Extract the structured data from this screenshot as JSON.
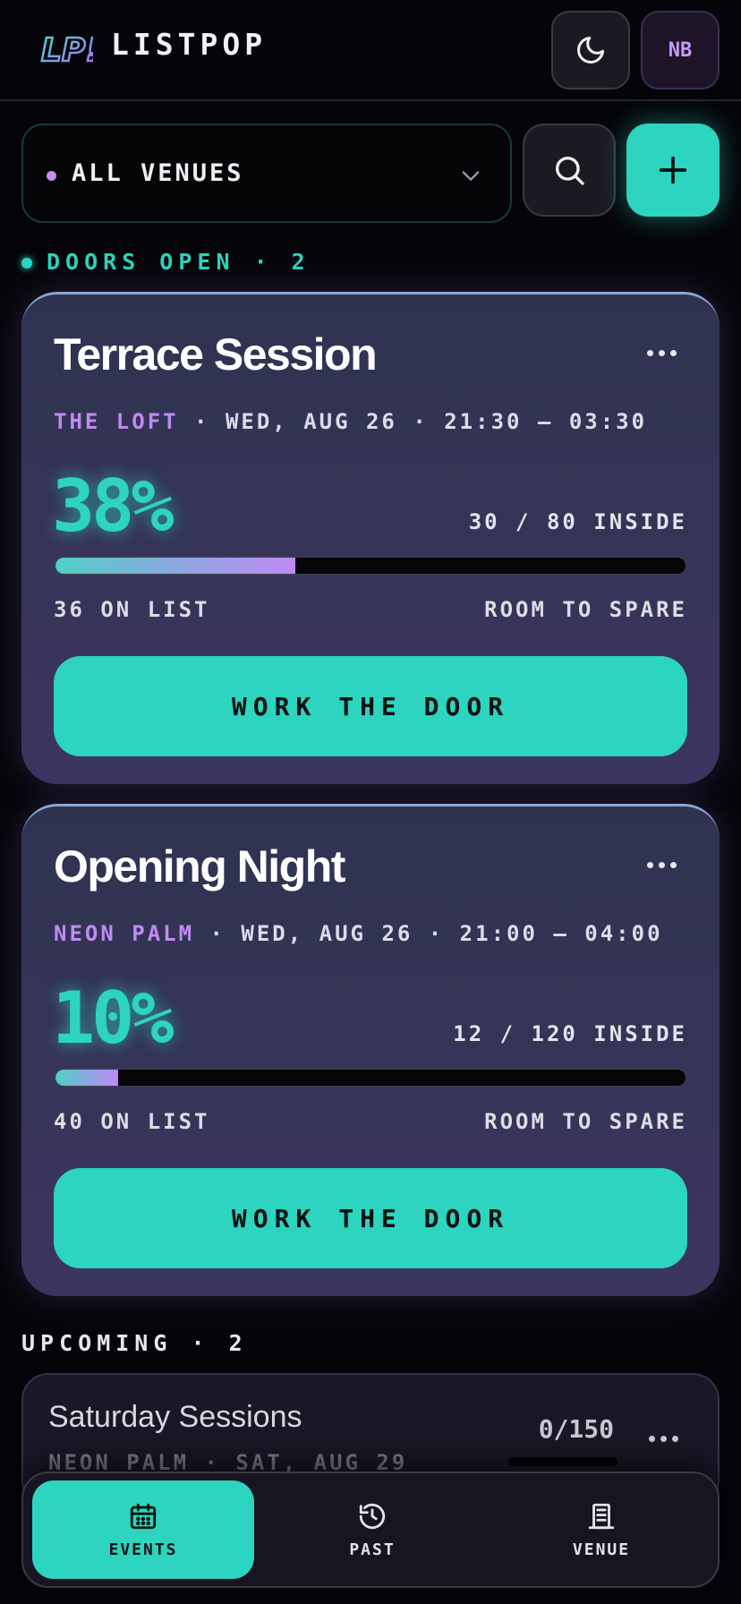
{
  "header": {
    "app_title": "LISTPOP",
    "logo_text": "LP!",
    "avatar_initials": "NB"
  },
  "filter": {
    "venue_select_value": "ALL VENUES"
  },
  "sections": {
    "doors_open": "DOORS OPEN · 2",
    "upcoming": "UPCOMING · 2"
  },
  "events_open": [
    {
      "title": "Terrace Session",
      "venue": "THE LOFT",
      "details": " · WED, AUG 26 · 21:30 — 03:30",
      "percent": "38%",
      "capacity": "30 / 80 INSIDE",
      "fill_fraction": 0.38,
      "on_list": "36 ON LIST",
      "status": "ROOM TO SPARE",
      "action": "WORK THE DOOR"
    },
    {
      "title": "Opening Night",
      "venue": "NEON PALM",
      "details": " · WED, AUG 26 · 21:00 — 04:00",
      "percent": "10%",
      "capacity": "12 / 120 INSIDE",
      "fill_fraction": 0.1,
      "on_list": "40 ON LIST",
      "status": "ROOM TO SPARE",
      "action": "WORK THE DOOR"
    }
  ],
  "events_upcoming": [
    {
      "title": "Saturday Sessions",
      "meta": "NEON PALM · SAT, AUG 29",
      "count": "0/150"
    }
  ],
  "nav": {
    "events": "EVENTS",
    "past": "PAST",
    "venue": "VENUE",
    "active": "events"
  },
  "colors": {
    "accent": "#2dd4bf",
    "venue_purple": "#c08af3",
    "background": "#050509"
  },
  "icons": {
    "theme": "moon-icon",
    "search": "search-icon",
    "add": "plus-icon",
    "menu": "more-horizontal-icon",
    "events": "calendar-icon",
    "past": "history-icon",
    "venue": "building-icon"
  }
}
